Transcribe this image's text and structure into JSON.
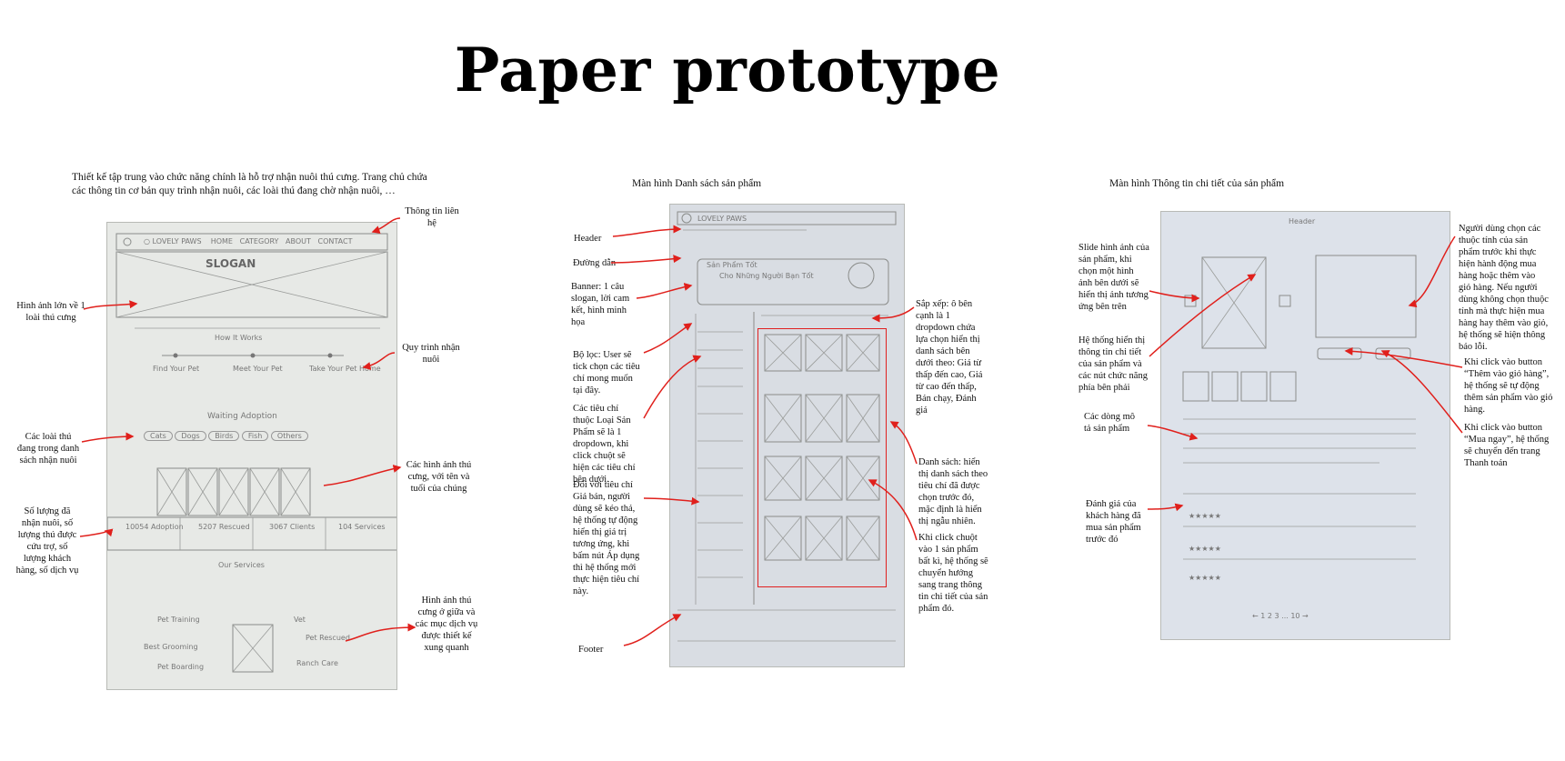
{
  "title": "Paper prototype",
  "sections": {
    "home": {
      "desc": "Thiết kế tập trung vào chức năng chính là hỗ trợ nhận nuôi thú cưng. Trang chủ chứa các thông tin cơ bản quy trình nhận nuôi, các loài thú đang chờ nhận nuôi, …",
      "notes": {
        "contact": "Thông tin liên hệ",
        "hero": "Hình ảnh lớn về 1 loài thú cưng",
        "process": "Quy trình nhận nuôi",
        "species": "Các loài thú đang trong danh sách nhận nuôi",
        "pets": "Các hình ảnh thú cưng, với tên và tuổi của chúng",
        "stats": "Số lượng đã nhận nuôi, số lượng thú được cứu trợ, số lượng khách hàng, số dịch vụ",
        "services": "Hình ảnh thú cưng ở giữa và các mục dịch vụ được thiết kế xung quanh"
      },
      "sketch": {
        "slogan": "SLOGAN",
        "how": "How It Works",
        "steps": [
          "Find Your Pet",
          "Meet Your Pet",
          "Take Your Pet Home"
        ],
        "waiting": "Waiting Adoption",
        "chips": [
          "Cats",
          "Dogs",
          "Birds",
          "Fish",
          "Others"
        ],
        "stats": [
          "10054 Adoption",
          "5207 Rescued",
          "3067 Clients",
          "104 Services"
        ],
        "services_title": "Our Services",
        "services": [
          "Pet Training",
          "Best Grooming",
          "Pet Boarding",
          "Vet",
          "Pet Rescued",
          "Ranch Care"
        ]
      }
    },
    "list": {
      "title": "Màn hình Danh sách sản phẩm",
      "notes": {
        "header": "Header",
        "breadcrumb": "Đường dẫn",
        "banner": "Banner: 1 câu slogan, lời cam kết, hình minh họa",
        "filter": "Bộ lọc: User sẽ tick chọn các tiêu chí mong muốn tại đây.",
        "category": "Các tiêu chí thuộc Loại Sản Phẩm sẽ là 1 dropdown, khi click chuột sẽ hiện các tiêu chí bên dưới.",
        "price": "Đối với tiêu chí Giá bán, người dùng sẽ kéo thả, hệ thống tự động hiển thị giá trị tương ứng, khi bấm nút Áp dụng thì hệ thống mới thực hiện tiêu chí này.",
        "footer": "Footer",
        "sort": "Sắp xếp: ô bên cạnh là 1 dropdown chứa lựa chọn hiển thị danh sách bên dưới theo: Giá từ thấp đến cao, Giá từ cao đến thấp, Bán chạy, Đánh giá",
        "listing": "Danh sách: hiển thị danh sách theo tiêu chí đã được chọn trước đó, mặc định là hiển thị ngẫu nhiên.",
        "click": "Khi click chuột vào 1 sản phẩm bất kì, hệ thống sẽ chuyển hướng sang trang thông tin chi tiết của sản phẩm đó."
      }
    },
    "detail": {
      "title": "Màn hình Thông tin chi tiết của sản phẩm",
      "notes": {
        "slide": "Slide hình ảnh của sản phẩm, khi chọn một hình ảnh bên dưới sẽ hiển thị ảnh tương ứng bên trên",
        "info": "Hệ thống hiển thị thông tin chi tiết của sản phẩm và các nút chức năng phía bên phải",
        "desc": "Các dòng mô tả sản phẩm",
        "reviews": "Đánh giá của khách hàng đã mua sản phẩm trước đó",
        "attrs": "Người dùng chọn các thuộc tính của sản phẩm trước khi thực hiện hành động mua hàng hoặc thêm vào giỏ hàng. Nếu người dùng không chọn thuộc tính mà thực hiện mua hàng hay thêm vào giỏ, hệ thống sẽ hiện thông báo lỗi.",
        "addcart": "Khi click vào button “Thêm vào giỏ hàng”, hệ thống sẽ tự động thêm sản phẩm vào giỏ hàng.",
        "buynow": "Khi click vào button “Mua ngay”, hệ thống sẽ chuyển đến trang Thanh toán"
      }
    }
  },
  "colors": {
    "arrow": "#e0201c",
    "highlight": "#e02020"
  }
}
